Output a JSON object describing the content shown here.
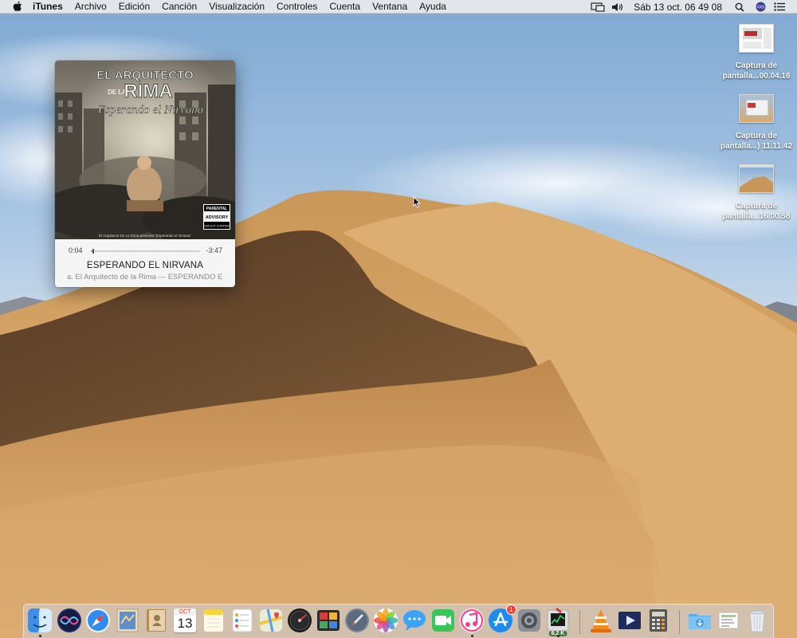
{
  "menubar": {
    "app_name": "iTunes",
    "menus": [
      "Archivo",
      "Edición",
      "Canción",
      "Visualización",
      "Controles",
      "Cuenta",
      "Ventana",
      "Ayuda"
    ],
    "clock": "Sáb 13 oct.  06 49 08",
    "status_icons": [
      "airplay-icon",
      "volume-icon",
      "search-icon",
      "siri-icon",
      "notification-center-icon"
    ]
  },
  "desktop_files": [
    {
      "line1": "Captura de",
      "line2": "pantalla...00.04.16"
    },
    {
      "line1": "Captura de",
      "line2": "pantalla...) 11.11.42"
    },
    {
      "line1": "Captura de",
      "line2": "pantalla...16.00.58"
    }
  ],
  "miniplayer": {
    "elapsed": "0:04",
    "remaining": "-3:47",
    "progress": 0.018,
    "title": "ESPERANDO EL NIRVANA",
    "subtitle": "a. El Arquitecto de la Rima — ESPERANDO E",
    "artwork": {
      "line_top": "EL ARQUITECTO",
      "line_de_la": "DE LA",
      "line_rima": "RIMA",
      "line_script": "Esperando el Nirvana",
      "footer_text": "El Arquitecto De La Rima presenta \"Esperando el nirvana\"",
      "advisory_1": "PARENTAL",
      "advisory_2": "ADVISORY",
      "advisory_3": "EXPLICIT CONTENT"
    }
  },
  "dock": {
    "calendar_month": "OCT",
    "calendar_day": "13",
    "appstore_badge": "1",
    "activity_label": "8,2 K",
    "apps": [
      "finder",
      "siri",
      "safari",
      "mail-stamp",
      "contacts",
      "calendar",
      "notes",
      "reminders",
      "maps",
      "dashboard",
      "photo-booth",
      "launchpad",
      "photos",
      "messages",
      "facetime",
      "itunes",
      "app-store",
      "system-preferences",
      "activity-monitor",
      "vlc",
      "quicktime",
      "calculator",
      "downloads",
      "documents",
      "trash"
    ]
  },
  "colors": {
    "sky_top": "#8fb4d8",
    "sky_bottom": "#e4e6ea",
    "sand_light": "#d9a466",
    "sand_shadow": "#5a3d22"
  }
}
